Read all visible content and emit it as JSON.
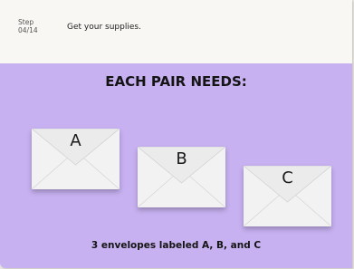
{
  "header": {
    "step_label": "Step",
    "step_counter": "04/14",
    "title": "Get your supplies."
  },
  "main": {
    "heading": "EACH PAIR NEEDS:",
    "envelopes": [
      {
        "label": "A"
      },
      {
        "label": "B"
      },
      {
        "label": "C"
      }
    ],
    "caption": "3 envelopes labeled A, B, and C"
  },
  "colors": {
    "panel_background": "#c7b1f1",
    "header_background": "#f8f7f4",
    "envelope_paper": "#f2f2f2"
  }
}
